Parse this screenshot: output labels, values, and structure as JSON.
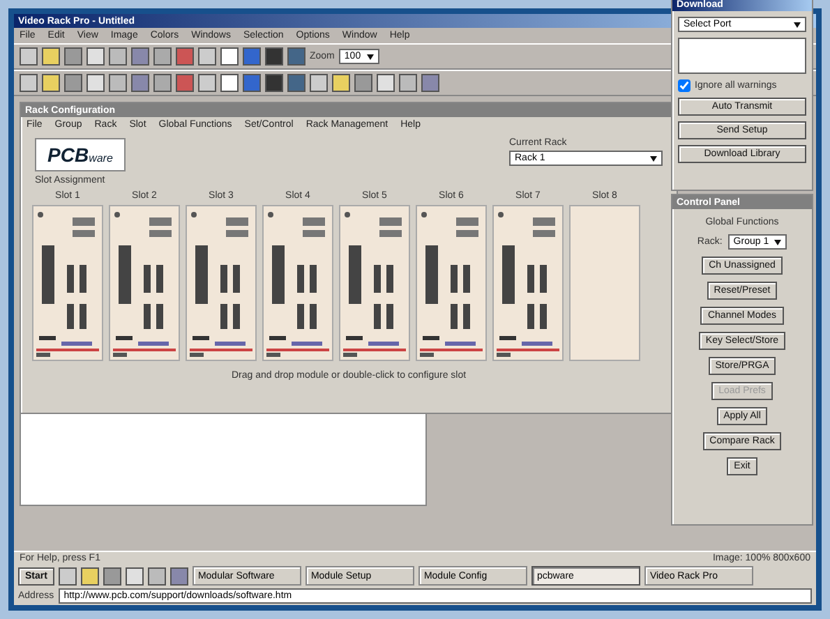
{
  "app": {
    "title": "Video Rack Pro - Untitled",
    "menu": [
      "File",
      "Edit",
      "View",
      "Image",
      "Colors",
      "Windows",
      "Selection",
      "Options",
      "Window",
      "Help"
    ],
    "zoom_label": "Zoom",
    "zoom": "100"
  },
  "rack_window": {
    "title": "Rack Configuration",
    "menu": [
      "File",
      "Group",
      "Rack",
      "Slot",
      "Global Functions",
      "Set/Control",
      "Rack Management",
      "Help"
    ],
    "logo": "PCB",
    "logo_suffix": "ware",
    "section_label": "Slot Assignment",
    "current_rack_label": "Current Rack",
    "current_rack": "Rack 1",
    "footer_note": "Drag and drop module or double-click to configure slot",
    "slots": [
      {
        "label": "Slot 1",
        "occupied": true
      },
      {
        "label": "Slot 2",
        "occupied": true
      },
      {
        "label": "Slot 3",
        "occupied": true
      },
      {
        "label": "Slot 4",
        "occupied": true
      },
      {
        "label": "Slot 5",
        "occupied": true
      },
      {
        "label": "Slot 6",
        "occupied": true
      },
      {
        "label": "Slot 7",
        "occupied": true
      },
      {
        "label": "Slot 8",
        "occupied": false
      }
    ]
  },
  "setup_panel": {
    "title": "Download",
    "dropdown": "Select Port",
    "checkbox_label": "Ignore all warnings",
    "checked": true,
    "buttons": [
      "Auto Transmit",
      "Send Setup",
      "Download Library"
    ]
  },
  "functions_panel": {
    "title": "Control Panel",
    "heading": "Global Functions",
    "rack_label": "Rack:",
    "rack": "Group 1",
    "buttons": [
      {
        "label": "Ch Unassigned",
        "disabled": false
      },
      {
        "label": "Reset/Preset",
        "disabled": false
      },
      {
        "label": "Channel Modes",
        "disabled": false
      },
      {
        "label": "Key Select/Store",
        "disabled": false
      },
      {
        "label": "Store/PRGA",
        "disabled": false
      },
      {
        "label": "Load Prefs",
        "disabled": true
      },
      {
        "label": "Apply All",
        "disabled": false
      },
      {
        "label": "Compare Rack",
        "disabled": false
      },
      {
        "label": "Exit",
        "disabled": false
      }
    ]
  },
  "status_bar": {
    "left": "For Help, press F1",
    "right": "Image: 100% 800x600"
  },
  "taskbar": {
    "start": "Start",
    "tasks": [
      {
        "label": "Modular Software",
        "active": false
      },
      {
        "label": "Module Setup",
        "active": false
      },
      {
        "label": "Module Config",
        "active": false
      },
      {
        "label": "pcbware",
        "active": true
      },
      {
        "label": "Video Rack Pro",
        "active": false
      }
    ],
    "address_label": "Address",
    "address": "http://www.pcb.com/support/downloads/software.htm"
  }
}
